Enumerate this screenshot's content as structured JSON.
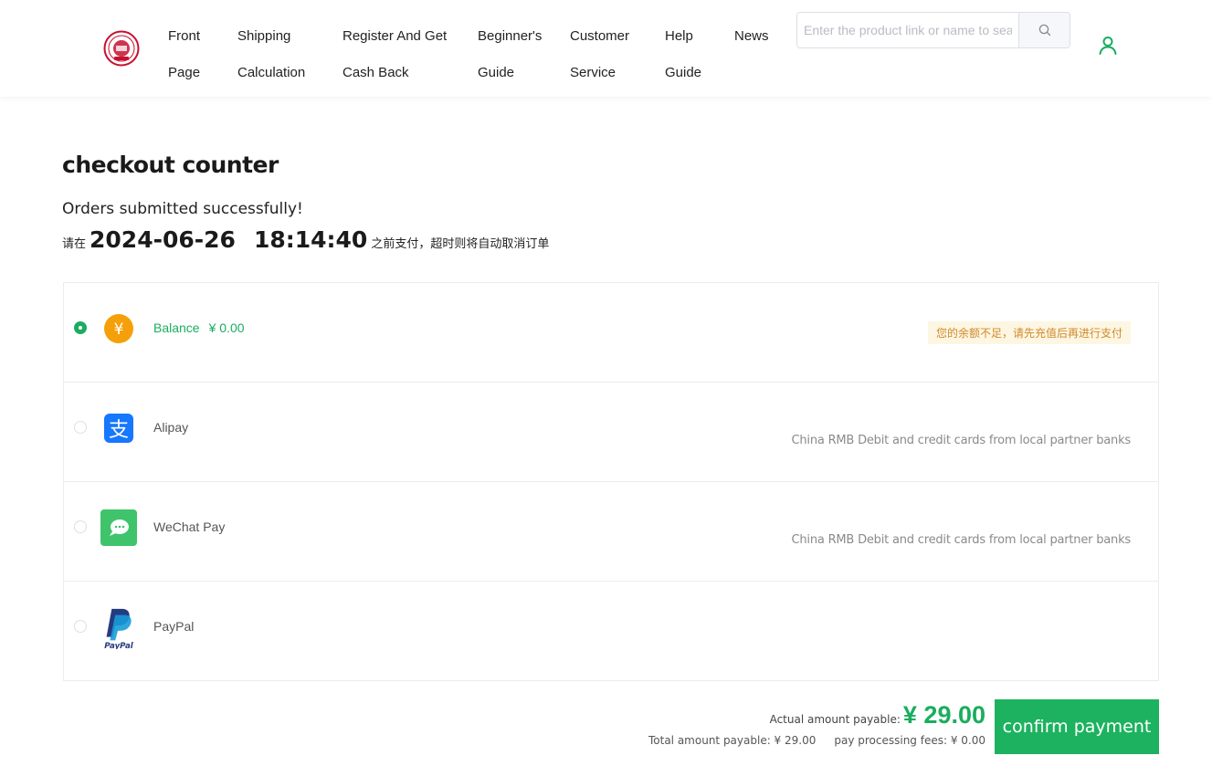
{
  "header": {
    "nav": [
      {
        "line1": "Front",
        "line2": "Page"
      },
      {
        "line1": "Shipping",
        "line2": "Calculation"
      },
      {
        "line1": "Register And Get",
        "line2": "Cash Back"
      },
      {
        "line1": "Beginner's",
        "line2": "Guide"
      },
      {
        "line1": "Customer",
        "line2": "Service"
      },
      {
        "line1": "Help",
        "line2": "Guide"
      },
      {
        "line1": "News",
        "line2": ""
      }
    ],
    "search": {
      "placeholder": "Enter the product link or name to search",
      "value": ""
    },
    "icons": {
      "logo": "seal-logo-icon",
      "search": "search-icon",
      "user": "user-icon"
    }
  },
  "main": {
    "title": "checkout counter",
    "success_message": "Orders submitted successfully!",
    "deadline": {
      "prefix": "请在",
      "date": "2024-06-26",
      "time": "18:14:40",
      "suffix": "之前支付，超时则将自动取消订单"
    }
  },
  "payment_methods": [
    {
      "name": "Balance",
      "amount": "¥ 0.00",
      "note": "您的余额不足，请先充值后再进行支付",
      "selected": true,
      "icon": "yuan-coin-icon"
    },
    {
      "name": "Alipay",
      "note": "China RMB Debit and credit cards from local partner banks",
      "selected": false,
      "icon": "alipay-icon"
    },
    {
      "name": "WeChat Pay",
      "note": "China RMB Debit and credit cards from local partner banks",
      "selected": false,
      "icon": "wechat-pay-icon"
    },
    {
      "name": "PayPal",
      "note": "",
      "selected": false,
      "icon": "paypal-icon"
    }
  ],
  "summary": {
    "actual_label": "Actual amount payable:",
    "actual_value": "¥ 29.00",
    "total_label": "Total amount payable: ¥ 29.00",
    "fees_label": "pay processing fees: ¥ 0.00",
    "confirm_label": "confirm payment"
  },
  "colors": {
    "accent": "#1aad5e",
    "warning_bg": "#fdf6e2",
    "warning_text": "#d08a2c",
    "alipay": "#1677ff",
    "wechat": "#3fc46c",
    "balance": "#f5a00a"
  }
}
